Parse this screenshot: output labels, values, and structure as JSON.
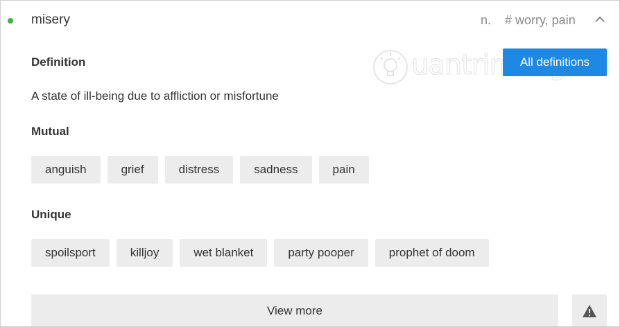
{
  "entry": {
    "word": "misery",
    "part_of_speech": "n.",
    "tags": "# worry, pain",
    "status_color": "#3cb54a"
  },
  "definition": {
    "label": "Definition",
    "text": "A state of ill-being due to affliction or misfortune",
    "all_definitions_label": "All definitions",
    "button_color": "#1e88e5"
  },
  "mutual": {
    "label": "Mutual",
    "items": [
      "anguish",
      "grief",
      "distress",
      "sadness",
      "pain"
    ]
  },
  "unique": {
    "label": "Unique",
    "items": [
      "spoilsport",
      "killjoy",
      "wet blanket",
      "party pooper",
      "prophet of doom"
    ]
  },
  "footer": {
    "view_more_label": "View more",
    "report_icon": "warning-icon"
  },
  "watermark": {
    "text": "uantrimang",
    "icon": "lightbulb-icon"
  }
}
